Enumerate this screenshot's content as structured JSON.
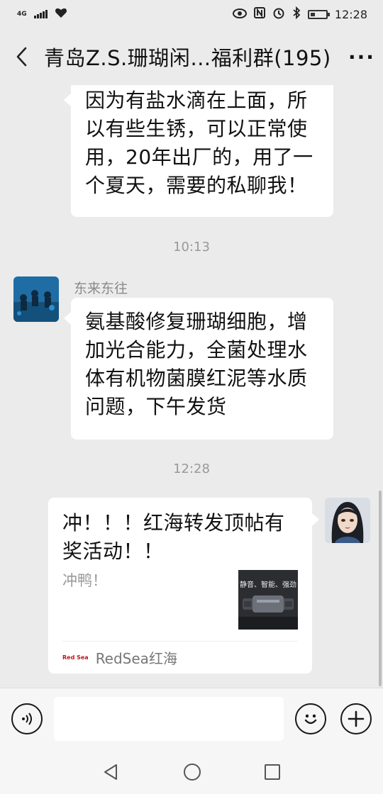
{
  "status_bar": {
    "network": "4G",
    "time": "12:28"
  },
  "header": {
    "title": "青岛Z.S.珊瑚闲…福利群(195)",
    "more_glyph": "···"
  },
  "messages": [
    {
      "text_lines": [
        "因为有盐水滴在上面，所",
        "以有些生锈，可以正常使",
        "用，20年出厂的，用了一",
        "个夏天，需要的私聊我！"
      ]
    },
    {
      "timestamp": "10:13"
    },
    {
      "sender": "东来东往",
      "text_lines": [
        "氨基酸修复珊瑚细胞，增",
        "加光合能力，全菌处理水",
        "体有机物菌膜红泥等水质",
        "问题，下午发货"
      ]
    },
    {
      "timestamp": "12:28"
    },
    {
      "card_title_lines": [
        "冲！！！红海转发顶帖有",
        "奖活动！！"
      ],
      "card_desc": "冲鸭！",
      "thumb_text": "静音、智能、强劲",
      "source_logo": "Red Sea",
      "source_name": "RedSea红海"
    }
  ],
  "colors": {
    "background": "#ebebeb",
    "bubble": "#ffffff",
    "muted_text": "#999999"
  }
}
